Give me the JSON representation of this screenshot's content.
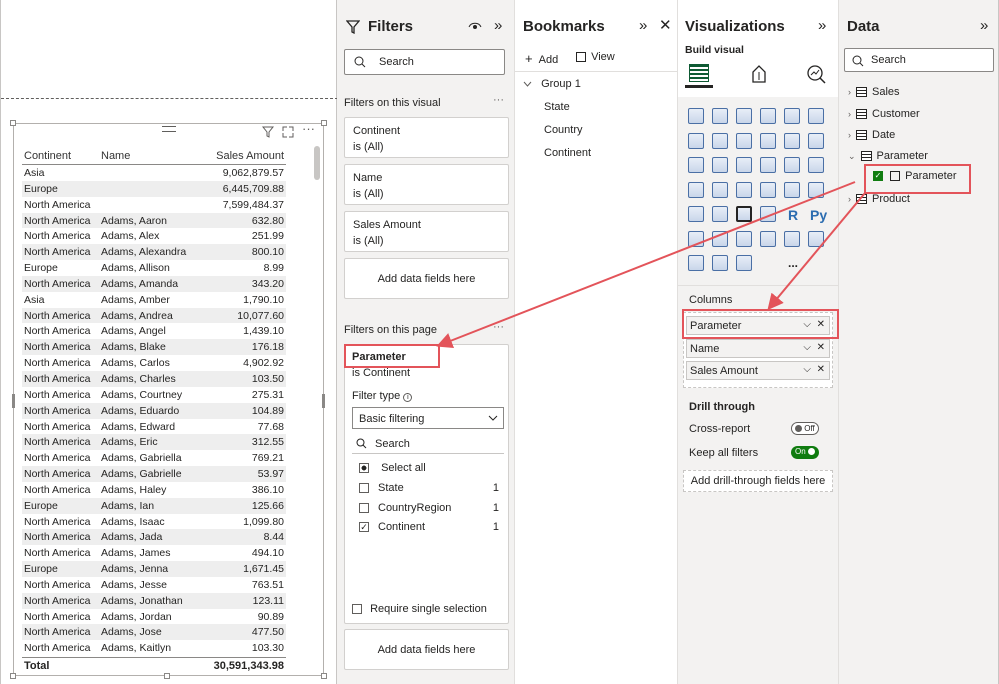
{
  "canvas": {
    "table": {
      "headers": [
        "Continent",
        "Name",
        "Sales Amount"
      ],
      "rows": [
        [
          "Asia",
          "",
          "9,062,879.57"
        ],
        [
          "Europe",
          "",
          "6,445,709.88"
        ],
        [
          "North America",
          "",
          "7,599,484.37"
        ],
        [
          "North America",
          "Adams, Aaron",
          "632.80"
        ],
        [
          "North America",
          "Adams, Alex",
          "251.99"
        ],
        [
          "North America",
          "Adams, Alexandra",
          "800.10"
        ],
        [
          "Europe",
          "Adams, Allison",
          "8.99"
        ],
        [
          "North America",
          "Adams, Amanda",
          "343.20"
        ],
        [
          "Asia",
          "Adams, Amber",
          "1,790.10"
        ],
        [
          "North America",
          "Adams, Andrea",
          "10,077.60"
        ],
        [
          "North America",
          "Adams, Angel",
          "1,439.10"
        ],
        [
          "North America",
          "Adams, Blake",
          "176.18"
        ],
        [
          "North America",
          "Adams, Carlos",
          "4,902.92"
        ],
        [
          "North America",
          "Adams, Charles",
          "103.50"
        ],
        [
          "North America",
          "Adams, Courtney",
          "275.31"
        ],
        [
          "North America",
          "Adams, Eduardo",
          "104.89"
        ],
        [
          "North America",
          "Adams, Edward",
          "77.68"
        ],
        [
          "North America",
          "Adams, Eric",
          "312.55"
        ],
        [
          "North America",
          "Adams, Gabriella",
          "769.21"
        ],
        [
          "North America",
          "Adams, Gabrielle",
          "53.97"
        ],
        [
          "North America",
          "Adams, Haley",
          "386.10"
        ],
        [
          "Europe",
          "Adams, Ian",
          "125.66"
        ],
        [
          "North America",
          "Adams, Isaac",
          "1,099.80"
        ],
        [
          "North America",
          "Adams, Jada",
          "8.44"
        ],
        [
          "North America",
          "Adams, James",
          "494.10"
        ],
        [
          "Europe",
          "Adams, Jenna",
          "1,671.45"
        ],
        [
          "North America",
          "Adams, Jesse",
          "763.51"
        ],
        [
          "North America",
          "Adams, Jonathan",
          "123.11"
        ],
        [
          "North America",
          "Adams, Jordan",
          "90.89"
        ],
        [
          "North America",
          "Adams, Jose",
          "477.50"
        ],
        [
          "North America",
          "Adams, Kaitlyn",
          "103.30"
        ]
      ],
      "total_label": "Total",
      "total_value": "30,591,343.98"
    }
  },
  "filters": {
    "title": "Filters",
    "search_placeholder": "Search",
    "on_visual_label": "Filters on this visual",
    "visual_cards": [
      {
        "name": "Continent",
        "state": "is (All)"
      },
      {
        "name": "Name",
        "state": "is (All)"
      },
      {
        "name": "Sales Amount",
        "state": "is (All)"
      }
    ],
    "add_fields": "Add data fields here",
    "on_page_label": "Filters on this page",
    "param_name": "Parameter",
    "param_state": "is Continent",
    "filter_type_label": "Filter type",
    "filter_type_value": "Basic filtering",
    "list_search": "Search",
    "select_all": "Select all",
    "options": [
      {
        "label": "State",
        "count": "1",
        "checked": false
      },
      {
        "label": "CountryRegion",
        "count": "1",
        "checked": false
      },
      {
        "label": "Continent",
        "count": "1",
        "checked": true
      }
    ],
    "require_single": "Require single selection",
    "add_fields_page": "Add data fields here"
  },
  "bookmarks": {
    "title": "Bookmarks",
    "add": "Add",
    "view": "View",
    "group": "Group 1",
    "items": [
      "State",
      "Country",
      "Continent"
    ]
  },
  "viz": {
    "title": "Visualizations",
    "build_visual": "Build visual",
    "columns_label": "Columns",
    "wells": [
      "Parameter",
      "Name",
      "Sales Amount"
    ],
    "drill_title": "Drill through",
    "cross_report": "Cross-report",
    "cross_toggle": "Off",
    "keep_filters": "Keep all filters",
    "keep_toggle": "On",
    "add_drill": "Add drill-through fields here",
    "r_glyph": "R",
    "py_glyph": "Py",
    "more_glyph": "..."
  },
  "data": {
    "title": "Data",
    "search_placeholder": "Search",
    "tables": [
      "Sales",
      "Customer",
      "Date",
      "Parameter",
      "Product"
    ],
    "param_field": "Parameter"
  },
  "colors": {
    "accent": "#e3545a",
    "toggle_on": "#107c10"
  }
}
